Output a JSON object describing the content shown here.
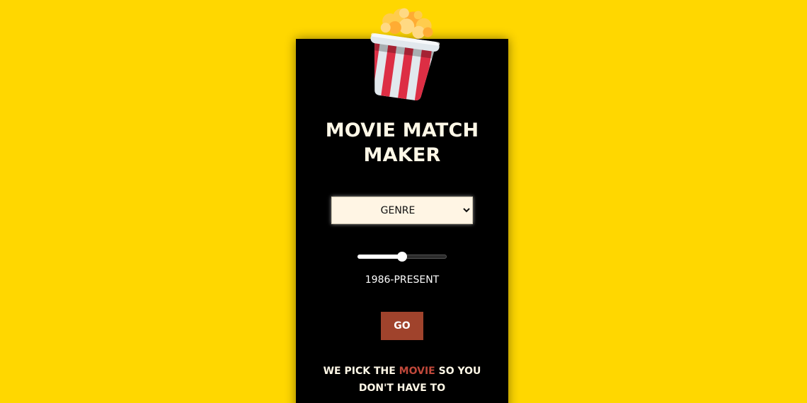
{
  "app": {
    "title_line1": "MOVIE MATCH",
    "title_line2": "MAKER",
    "logo_icon": "popcorn-icon"
  },
  "form": {
    "genre_select": {
      "selected": "GENRE",
      "options": [
        "GENRE"
      ]
    },
    "era_slider": {
      "value_fraction": 0.5,
      "label": "1986-PRESENT"
    },
    "go_label": "GO"
  },
  "tagline": {
    "part1": "WE PICK THE ",
    "accent": "MOVIE",
    "part2": " SO YOU DON'T HAVE TO"
  },
  "colors": {
    "background": "#ffd700",
    "card": "#000000",
    "button": "#a0432c",
    "accent_text": "#c0483a",
    "popcorn_stripe_red": "#dd2e44",
    "popcorn_stripe_white": "#e1e8ed",
    "popcorn_kernel": "#ffcc4d"
  }
}
